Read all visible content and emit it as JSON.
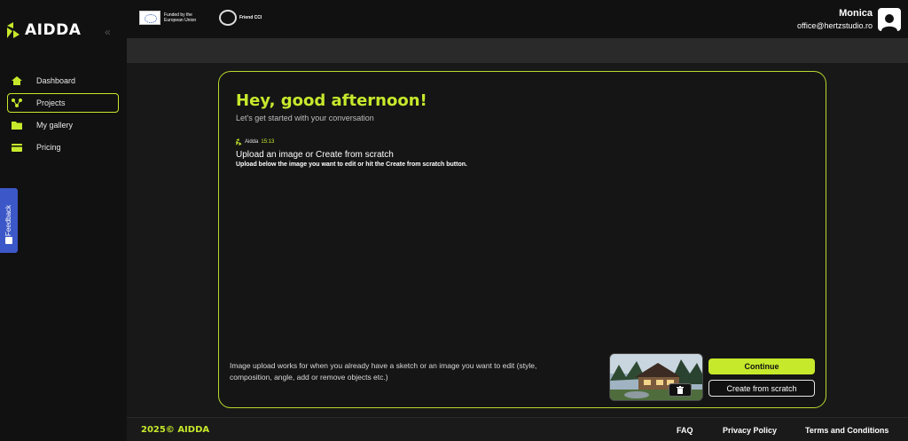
{
  "brand": {
    "name": "AIDDA",
    "accent": "#c6e92c"
  },
  "sidebar": {
    "collapse_icon": "chevron-double-left-icon",
    "items": [
      {
        "label": "Dashboard",
        "icon": "home-icon",
        "active": false
      },
      {
        "label": "Projects",
        "icon": "network-icon",
        "active": true
      },
      {
        "label": "My gallery",
        "icon": "folder-icon",
        "active": false
      },
      {
        "label": "Pricing",
        "icon": "wallet-icon",
        "active": false
      }
    ],
    "feedback_label": "Feedback"
  },
  "header": {
    "eu_text": "Funded by the European Union",
    "friend_text": "Friend CCI",
    "user_name": "Monica",
    "user_email": "office@hertzstudio.ro"
  },
  "main": {
    "greeting": "Hey, good afternoon!",
    "subtitle": "Let's get started with your conversation",
    "message": {
      "sender": "Aidda",
      "time": "15:13",
      "title": "Upload an image or Create from scratch",
      "body": "Upload below the image you want to edit or hit the Create from scratch button."
    },
    "hint": "Image upload works for when you already have a sketch or an image you want to edit (style, composition, angle, add or remove objects etc.)",
    "continue_label": "Continue",
    "scratch_label": "Create from scratch"
  },
  "footer": {
    "copyright": "2025© AIDDA",
    "links": [
      "FAQ",
      "Privacy Policy",
      "Terms and Conditions"
    ]
  }
}
